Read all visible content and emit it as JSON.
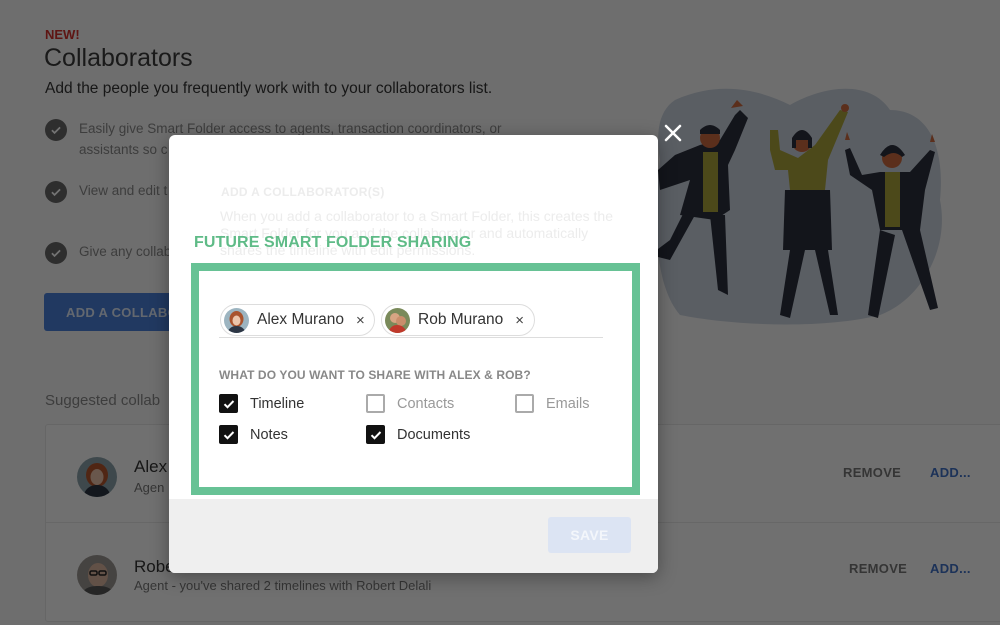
{
  "page": {
    "badge": "NEW!",
    "title": "Collaborators",
    "subtitle": "Add the people you frequently work with to your collaborators list.",
    "benefits": [
      "Easily give Smart Folder access to agents, transaction coordinators, or assistants so c",
      "View and edit t the clients and",
      "Give any collab"
    ],
    "add_collaborator_button": "ADD A COLLABO",
    "suggested_label": "Suggested collab",
    "collaborators": [
      {
        "name": "Alex",
        "description": "Agen",
        "remove_label": "REMOVE",
        "add_label": "ADD..."
      },
      {
        "name": "Robe",
        "description": "Agent - you've shared 2 timelines with Robert Delali",
        "remove_label": "REMOVE",
        "add_label": "ADD..."
      }
    ]
  },
  "modal": {
    "ghost_title": "ADD A COLLABORATOR(S)",
    "ghost_text": "When you add a collaborator to a Smart Folder, this creates the Smart Folder for you and the collaborator and automatically shares the timeline with edit permissions.",
    "section_label": "FUTURE SMART FOLDER SHARING",
    "chips": [
      {
        "name": "Alex Murano",
        "remove_glyph": "×"
      },
      {
        "name": "Rob Murano",
        "remove_glyph": "×"
      }
    ],
    "share_question": "WHAT DO YOU WANT TO SHARE WITH ALEX & ROB?",
    "options": [
      {
        "label": "Timeline",
        "checked": true
      },
      {
        "label": "Contacts",
        "checked": false
      },
      {
        "label": "Emails",
        "checked": false
      },
      {
        "label": "Notes",
        "checked": true
      },
      {
        "label": "Documents",
        "checked": true
      }
    ],
    "save_button": "SAVE",
    "close_icon": "close-icon"
  },
  "colors": {
    "accent_green": "#67c295",
    "badge_red": "#d0302a",
    "primary_blue": "#4a7fd8"
  }
}
